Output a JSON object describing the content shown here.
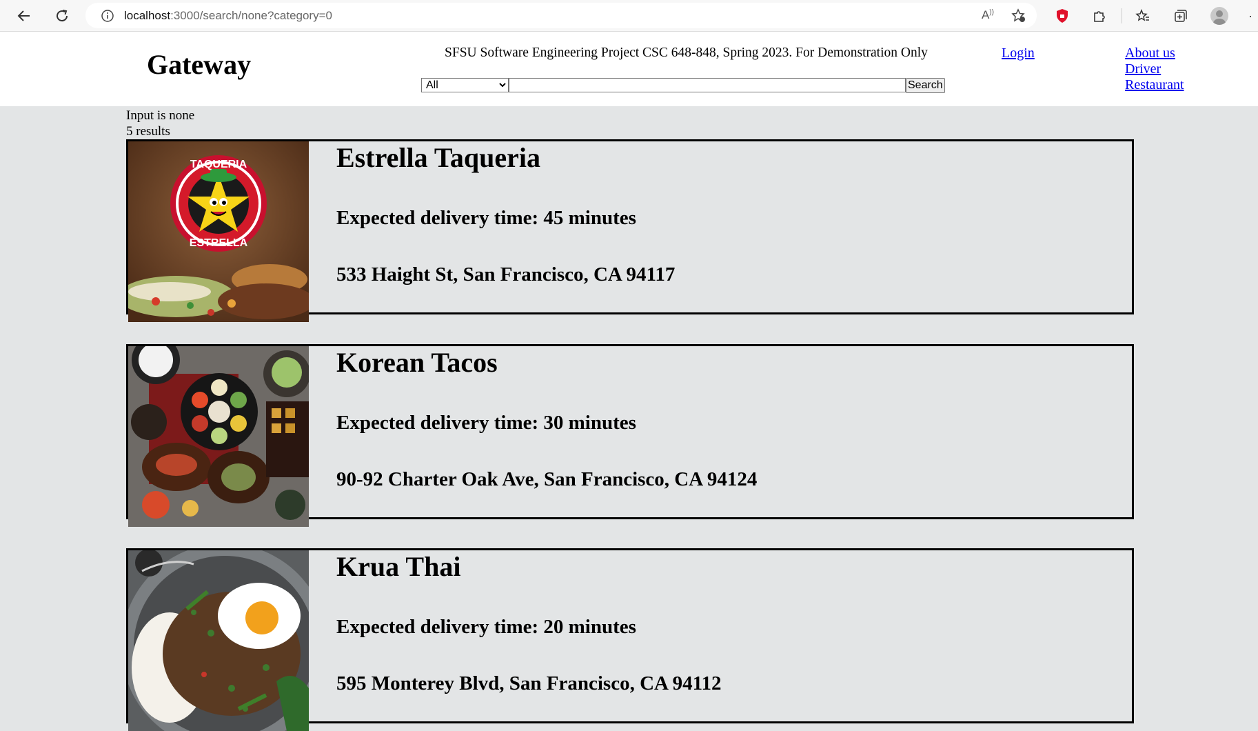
{
  "browser": {
    "url_host": "localhost",
    "url_path": ":3000/search/none?category=0"
  },
  "header": {
    "brand": "Gateway",
    "tagline": "SFSU Software Engineering Project CSC 648-848, Spring 2023. For Demonstration Only",
    "search": {
      "category_selected": "All",
      "query_value": "",
      "button_label": "Search"
    },
    "login_label": "Login",
    "nav": {
      "about": "About us",
      "driver": "Driver",
      "restaurant": "Restaurant"
    }
  },
  "results": {
    "input_text": "Input is none",
    "count_text": "5 results",
    "items": [
      {
        "name": "Estrella Taqueria",
        "delivery": "Expected delivery time: 45 minutes",
        "address": "533 Haight St, San Francisco, CA 94117",
        "logo_top": "TAQUERIA",
        "logo_bottom": "ESTRELLA"
      },
      {
        "name": "Korean Tacos",
        "delivery": "Expected delivery time: 30 minutes",
        "address": "90-92 Charter Oak Ave, San Francisco, CA 94124"
      },
      {
        "name": "Krua Thai",
        "delivery": "Expected delivery time: 20 minutes",
        "address": "595 Monterey Blvd, San Francisco, CA 94112"
      }
    ]
  },
  "colors": {
    "page_bg": "#e3e5e6",
    "header_bg": "#ffffff",
    "link": "#0000ee"
  }
}
